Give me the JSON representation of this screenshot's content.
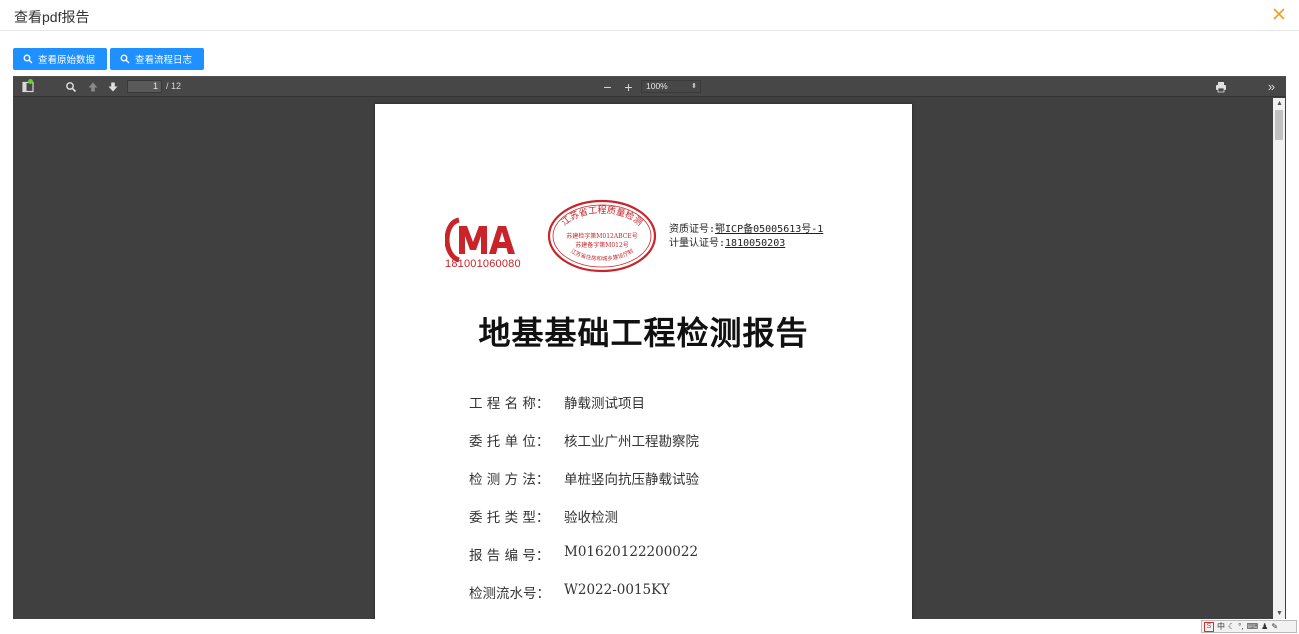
{
  "dialog": {
    "title": "查看pdf报告"
  },
  "buttons": {
    "raw_data": "查看原始数据",
    "flow_log": "查看流程日志"
  },
  "toolbar": {
    "page_current": "1",
    "page_count": "/ 12",
    "zoom": "100%",
    "zoom_out": "−",
    "zoom_in": "+"
  },
  "document": {
    "ma_number": "181001060080",
    "seal_top": "江苏省工程质量检测",
    "seal_line1": "苏建检字第M012ABCE号",
    "seal_line2": "苏建备字第M012号",
    "seal_bottom": "江苏省住房和城乡建设厅制",
    "qualification_label": "资质证号:",
    "qualification_value": "鄂ICP备05005613号-1",
    "metrology_label": "计量认证号:",
    "metrology_value": "1810050203",
    "title": "地基基础工程检测报告",
    "fields": [
      {
        "label": "工 程 名 称：",
        "value": "静载测试项目"
      },
      {
        "label": "委 托 单 位：",
        "value": "核工业广州工程勘察院"
      },
      {
        "label": "检 测 方 法：",
        "value": "单桩竖向抗压静载试验"
      },
      {
        "label": "委 托 类 型：",
        "value": "验收检测"
      },
      {
        "label": "报 告 编 号：",
        "value": "M01620122200022"
      },
      {
        "label": "检测流水号：",
        "value": "W2022-0015KY"
      }
    ]
  },
  "ime": {
    "lang": "中"
  },
  "colors": {
    "accent": "#1e90ff",
    "close": "#f0a020",
    "seal_red": "#c8242a"
  }
}
